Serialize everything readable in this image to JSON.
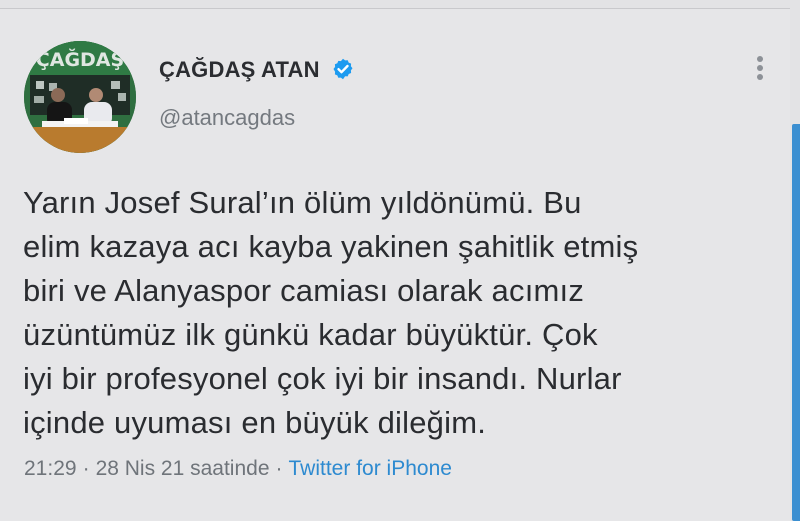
{
  "author": {
    "display_name": "ÇAĞDAŞ ATAN",
    "handle": "@atancagdas",
    "verified": true,
    "avatar_text": "ÇAĞDAŞ"
  },
  "tweet": {
    "lines": [
      "Yarın Josef Sural’ın ölüm yıldönümü. Bu",
      "elim kazaya acı kayba yakinen şahitlik etmiş",
      "biri ve Alanyaspor camiası olarak acımız",
      "üzüntümüz ilk günkü kadar büyüktür. Çok",
      "iyi bir profesyonel çok iyi bir insandı. Nurlar",
      "içinde uyuması en büyük dileğim."
    ]
  },
  "meta": {
    "time": "21:29",
    "date": "28 Nis 21 saatinde",
    "separator": "·",
    "source": "Twitter for iPhone"
  },
  "icons": {
    "verified": "verified-badge-icon",
    "more": "more-vertical-icon"
  },
  "colors": {
    "background": "#e6e6e8",
    "verified": "#1d9bf0",
    "link": "#2d8ad0",
    "scrollbar": "#3b8fd1"
  }
}
